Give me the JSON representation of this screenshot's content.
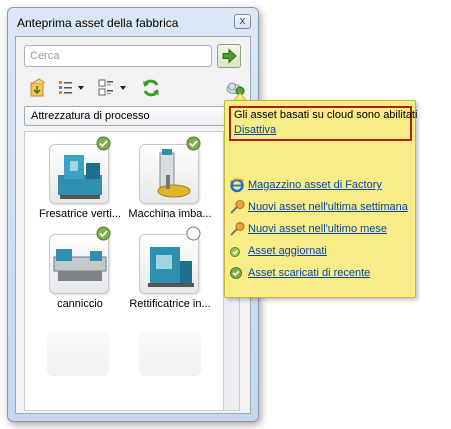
{
  "window": {
    "title": "Anteprima asset della fabbrica",
    "close_label": "x"
  },
  "search": {
    "placeholder": "Cerca",
    "value": ""
  },
  "toolbar": {
    "icons": [
      "import-asset-icon",
      "list-view-icon",
      "tile-view-icon",
      "refresh-icon"
    ]
  },
  "category": {
    "selected": "Attrezzatura di processo"
  },
  "assets": [
    {
      "label": "Fresatrice verti...",
      "status": "downloaded"
    },
    {
      "label": "Macchina imba...",
      "status": "downloaded"
    },
    {
      "label": "canniccio",
      "status": "downloaded"
    },
    {
      "label": "Rettificatrice in...",
      "status": "not-downloaded"
    }
  ],
  "tooltip": {
    "message": "Gli asset basati su cloud sono abilitati",
    "disable_link": "Disattiva",
    "links": [
      {
        "label": "Magazzino asset di Factory",
        "icon": "browser-icon"
      },
      {
        "label": "Nuovi asset nell'ultima settimana",
        "icon": "new-asset-week-icon"
      },
      {
        "label": "Nuovi asset nell'ultimo mese",
        "icon": "new-asset-month-icon"
      },
      {
        "label": "Asset aggiornati",
        "icon": "updated-asset-icon"
      },
      {
        "label": "Asset scaricati di recente",
        "icon": "downloaded-asset-icon"
      }
    ]
  },
  "colors": {
    "tooltip_bg": "#f8ec86",
    "highlight_border": "#b41e1e",
    "link": "#0645ad",
    "check_green": "#7fae4c"
  }
}
